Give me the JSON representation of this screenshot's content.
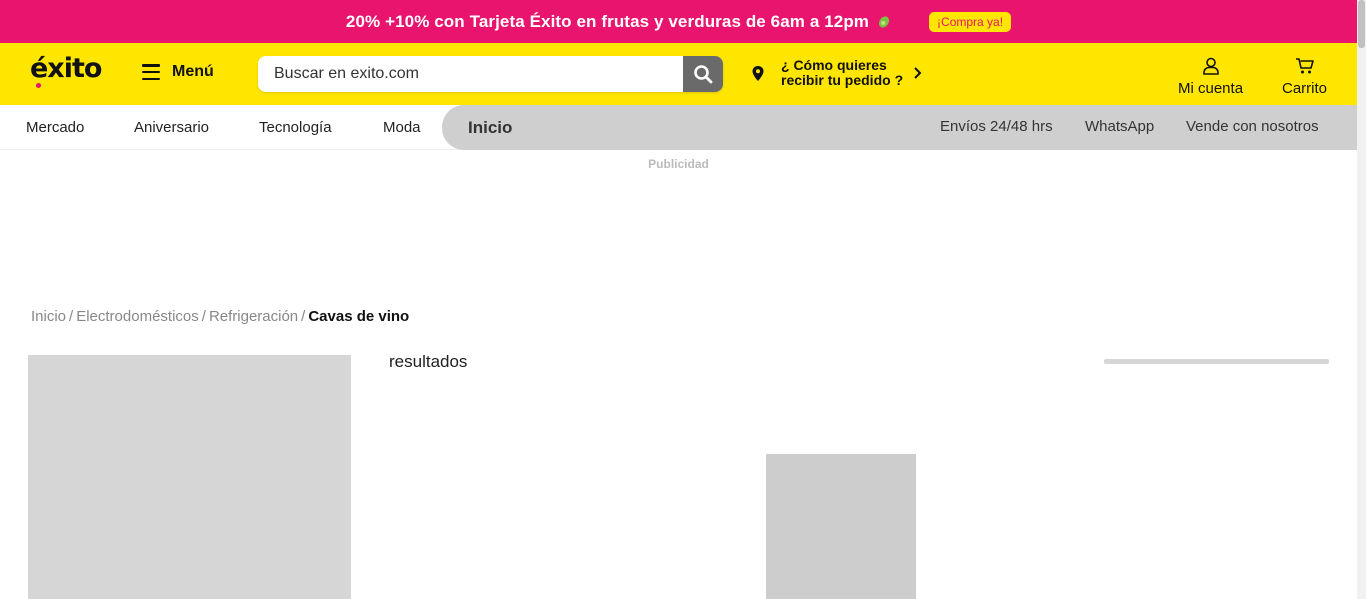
{
  "promo": {
    "text": "20% +10% con Tarjeta Éxito en frutas y verduras de 6am a 12pm",
    "icon": "avocado-icon",
    "cta": "¡Compra ya!"
  },
  "header": {
    "logo": "éxito",
    "menu_label": "Menú",
    "search_placeholder": "Buscar en exito.com",
    "delivery_line1": "¿ Cómo quieres",
    "delivery_line2": "recibir tu pedido ?",
    "account_label": "Mi cuenta",
    "cart_label": "Carrito"
  },
  "nav": {
    "items": [
      "Mercado",
      "Aniversario",
      "Tecnología",
      "Moda"
    ],
    "active": "Inicio",
    "right_items": [
      "Envíos 24/48 hrs",
      "WhatsApp",
      "Vende con nosotros"
    ]
  },
  "ad_label": "Publicidad",
  "breadcrumb": {
    "items": [
      "Inicio",
      "Electrodomésticos",
      "Refrigeración"
    ],
    "current": "Cavas de vino"
  },
  "results_label": "resultados",
  "colors": {
    "brand_yellow": "#ffe600",
    "brand_pink": "#e8146e",
    "skeleton": "#d6d6d6"
  }
}
